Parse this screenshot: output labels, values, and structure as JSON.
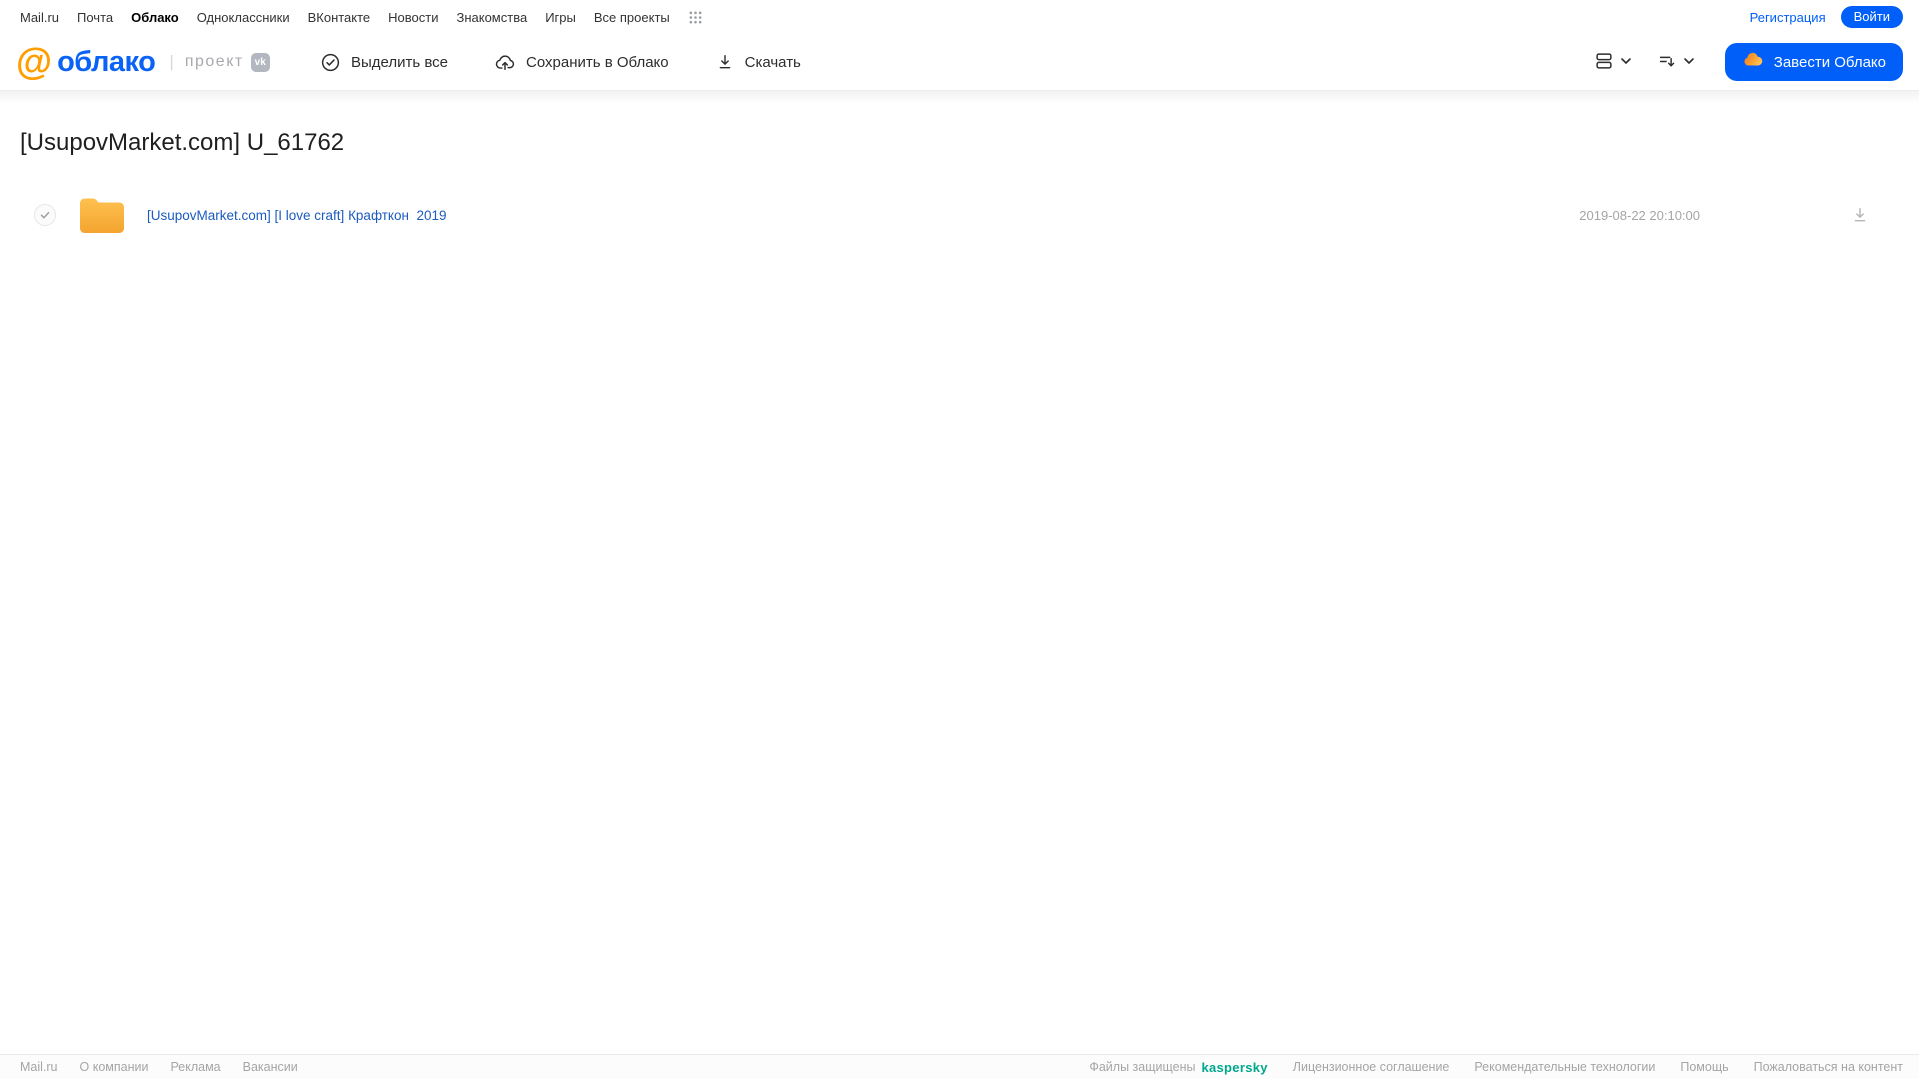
{
  "topnav": {
    "links": [
      "Mail.ru",
      "Почта",
      "Облако",
      "Одноклассники",
      "ВКонтакте",
      "Новости",
      "Знакомства",
      "Игры",
      "Все проекты"
    ],
    "active_link": "Облако",
    "registration": "Регистрация",
    "login": "Войти"
  },
  "header": {
    "logo_at": "@",
    "logo_word": "облако",
    "logo_separator": "|",
    "project_label": "проект",
    "vk_badge": "vk",
    "toolbar": {
      "select_all": "Выделить все",
      "save_to_cloud": "Сохранить в Облако",
      "download": "Скачать"
    },
    "get_cloud_button": "Завести Облако"
  },
  "page": {
    "title": "[UsupovMarket.com] U_61762"
  },
  "files": [
    {
      "type": "folder",
      "name": "[UsupovMarket.com] [I love craft] Крафткон  2019",
      "date": "2019-08-22 20:10:00"
    }
  ],
  "footer": {
    "left_links": [
      "Mail.ru",
      "О компании",
      "Реклама",
      "Вакансии"
    ],
    "protected_label": "Файлы защищены",
    "kaspersky": "kaspersky",
    "right_links": [
      "Лицензионное соглашение",
      "Рекомендательные технологии",
      "Помощь",
      "Пожаловаться на контент"
    ]
  },
  "colors": {
    "brand_blue": "#005ff9",
    "logo_orange": "#ff9e00",
    "logo_blue": "#0b63f6",
    "file_link_blue": "#1b5bbf",
    "kaspersky_green": "#00a88e",
    "folder_orange_top": "#ffc14f",
    "folder_orange_bottom": "#f3a42f"
  }
}
